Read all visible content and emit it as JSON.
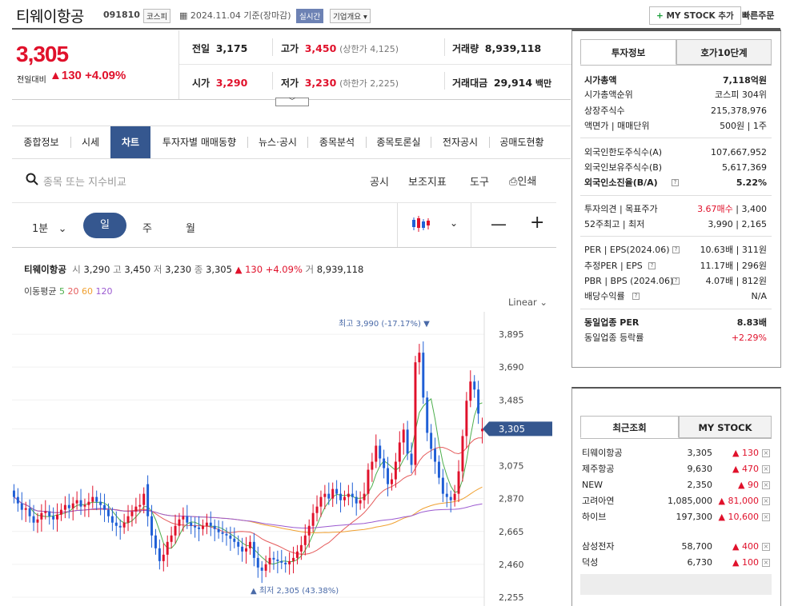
{
  "header": {
    "name": "티웨이항공",
    "code": "091810",
    "market": "코스피",
    "date_info": "2024.11.04 기준(장마감)",
    "realtime": "실시간",
    "company_info": "기업개요",
    "mystock_btn": "MY STOCK 추가",
    "quick_order": "빠른주문"
  },
  "price": {
    "current": "3,305",
    "prev_label": "전일대비",
    "change": "130",
    "change_pct": "+4.09%"
  },
  "quote": {
    "prev_label": "전일",
    "prev": "3,175",
    "high_label": "고가",
    "high": "3,450",
    "upper": "(상한가 4,125)",
    "volume_label": "거래량",
    "volume": "8,939,118",
    "open_label": "시가",
    "open": "3,290",
    "low_label": "저가",
    "low": "3,230",
    "lower": "(하한가 2,225)",
    "amount_label": "거래대금",
    "amount": "29,914",
    "amount_unit": "백만"
  },
  "tabs": [
    "종합정보",
    "시세",
    "차트",
    "투자자별 매매동향",
    "뉴스·공시",
    "종목분석",
    "종목토론실",
    "전자공시",
    "공매도현황"
  ],
  "chart_toolbar": {
    "search_placeholder": "종목 또는 지수비교",
    "disclosure": "공시",
    "indicators": "보조지표",
    "drawing": "도구",
    "print": "인쇄",
    "interval": "1분",
    "periods": [
      "일",
      "주",
      "월"
    ],
    "scale": "Linear"
  },
  "chart_info": {
    "name": "티웨이항공",
    "open_l": "시",
    "open": "3,290",
    "high_l": "고",
    "high": "3,450",
    "low_l": "저",
    "low": "3,230",
    "close_l": "종",
    "close": "3,305",
    "change": "▲ 130",
    "pct": "+4.09%",
    "vol_l": "거",
    "vol": "8,939,118",
    "ma_label": "이동평균",
    "ma": [
      "5",
      "20",
      "60",
      "120"
    ]
  },
  "chart_data": {
    "type": "candlestick",
    "y_ticks": [
      "3,895",
      "3,690",
      "3,485",
      "3,305",
      "3,075",
      "2,870",
      "2,665",
      "2,460",
      "2,255"
    ],
    "ylim": [
      2230,
      4010
    ],
    "current_price_tag": "3,305",
    "max_label": "최고 3,990 (-17.17%)",
    "min_label": "최저 2,305 (43.38%)",
    "colors": {
      "up": "#e0112b",
      "down": "#1f5fd6",
      "ma5": "#4cae4c",
      "ma20": "#e55b5b",
      "ma60": "#f0a030",
      "ma120": "#9b59d0"
    },
    "ma_colors": [
      "#4cae4c",
      "#e55b5b",
      "#f0a030",
      "#9b59d0"
    ],
    "closes": [
      2880,
      2840,
      2800,
      2810,
      2760,
      2720,
      2740,
      2780,
      2790,
      2760,
      2740,
      2770,
      2800,
      2830,
      2810,
      2840,
      2860,
      2820,
      2830,
      2850,
      2880,
      2850,
      2830,
      2800,
      2760,
      2720,
      2700,
      2690,
      2720,
      2760,
      2790,
      2820,
      2830,
      2900,
      2760,
      2640,
      2560,
      2480,
      2520,
      2600,
      2640,
      2700,
      2740,
      2760,
      2720,
      2700,
      2690,
      2680,
      2700,
      2720,
      2700,
      2680,
      2660,
      2650,
      2640,
      2620,
      2600,
      2570,
      2540,
      2560,
      2600,
      2500,
      2440,
      2420,
      2460,
      2500,
      2490,
      2480,
      2470,
      2460,
      2480,
      2500,
      2540,
      2580,
      2640,
      2700,
      2780,
      2820,
      2880,
      2900,
      2870,
      2930,
      2900,
      2860,
      2880,
      2900,
      2880,
      2840,
      2860,
      2900,
      3050,
      3100,
      3200,
      3120,
      3060,
      2960,
      2990,
      3100,
      3220,
      3300,
      3150,
      3080,
      3720,
      3780,
      3500,
      3280,
      3180,
      3100,
      3000,
      2900,
      2880,
      2860,
      2900,
      3040,
      3260,
      3480,
      3600,
      3550,
      3400,
      3305
    ],
    "opens": [
      2920,
      2880,
      2840,
      2800,
      2810,
      2760,
      2720,
      2740,
      2780,
      2790,
      2760,
      2740,
      2770,
      2800,
      2830,
      2810,
      2840,
      2860,
      2820,
      2830,
      2850,
      2880,
      2850,
      2830,
      2800,
      2760,
      2720,
      2700,
      2690,
      2720,
      2760,
      2790,
      2820,
      2830,
      2960,
      2760,
      2640,
      2560,
      2480,
      2520,
      2600,
      2640,
      2700,
      2740,
      2760,
      2720,
      2700,
      2690,
      2680,
      2700,
      2720,
      2700,
      2680,
      2660,
      2650,
      2640,
      2620,
      2600,
      2570,
      2540,
      2560,
      2600,
      2500,
      2440,
      2420,
      2460,
      2500,
      2490,
      2480,
      2470,
      2460,
      2480,
      2500,
      2540,
      2580,
      2640,
      2700,
      2780,
      2820,
      2880,
      2900,
      2870,
      2930,
      2900,
      2860,
      2880,
      2900,
      2880,
      2840,
      2860,
      2900,
      3050,
      3100,
      3200,
      3120,
      3060,
      2960,
      2990,
      3100,
      3220,
      3300,
      3150,
      3080,
      3720,
      3780,
      3500,
      3280,
      3180,
      3100,
      3000,
      2900,
      2880,
      2860,
      2900,
      3040,
      3260,
      3480,
      3600,
      3550,
      3290
    ]
  },
  "info_panel": {
    "tab1": "투자정보",
    "tab2": "호가10단계",
    "rows1": [
      {
        "l": "시가총액",
        "r": "7,118억원"
      },
      {
        "l": "시가총액순위",
        "r": "코스피 304위"
      },
      {
        "l": "상장주식수",
        "r": "215,378,976"
      },
      {
        "l": "액면가 | 매매단위",
        "r": "500원 | 1주"
      }
    ],
    "rows2": [
      {
        "l": "외국인한도주식수(A)",
        "r": "107,667,952"
      },
      {
        "l": "외국인보유주식수(B)",
        "r": "5,617,369"
      },
      {
        "l": "외국인소진율(B/A)",
        "r": "5.22%"
      }
    ],
    "rows3": [
      {
        "l": "투자의견 | 목표주가",
        "r1": "3.67매수",
        "r2": " | 3,400"
      },
      {
        "l": "52주최고 | 최저",
        "r": "3,990 | 2,165"
      }
    ],
    "rows4": [
      {
        "l": "PER | EPS(2024.06)",
        "r": "10.63배 | 311원"
      },
      {
        "l": "추정PER | EPS",
        "r": "11.17배 | 296원"
      },
      {
        "l": "PBR | BPS (2024.06)",
        "r": "4.07배 | 812원"
      },
      {
        "l": "배당수익률",
        "r": "N/A"
      }
    ],
    "rows5": [
      {
        "l": "동일업종 PER",
        "r": "8.83배"
      },
      {
        "l": "동일업종 등락률",
        "r": "+2.29%"
      }
    ]
  },
  "recent_panel": {
    "tab1": "최근조회",
    "tab2": "MY STOCK",
    "items": [
      {
        "name": "티웨이항공",
        "price": "3,305",
        "chg": "▲ 130"
      },
      {
        "name": "제주항공",
        "price": "9,630",
        "chg": "▲ 470"
      },
      {
        "name": "NEW",
        "price": "2,350",
        "chg": "▲ 90"
      },
      {
        "name": "고려아연",
        "price": "1,085,000",
        "chg": "▲ 81,000"
      },
      {
        "name": "하이브",
        "price": "197,300",
        "chg": "▲ 10,600"
      }
    ],
    "items2": [
      {
        "name": "삼성전자",
        "price": "58,700",
        "chg": "▲ 400"
      },
      {
        "name": "덕성",
        "price": "6,730",
        "chg": "▲ 100"
      }
    ]
  }
}
